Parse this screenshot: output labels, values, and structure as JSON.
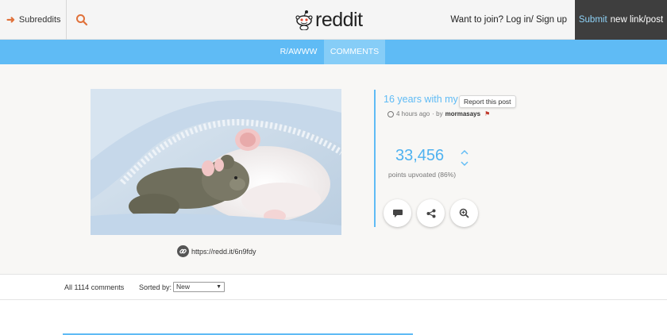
{
  "header": {
    "subreddits_label": "Subreddits",
    "logo_text": "reddit",
    "join_text": "Want to join? Log in/ Sign up",
    "submit_accent": "Submit",
    "submit_rest": "new link/post"
  },
  "nav": {
    "tabs": [
      {
        "label": "R/AWWW"
      },
      {
        "label": "COMMENTS"
      }
    ]
  },
  "post": {
    "title": "16 years with my",
    "tooltip": "Report this post",
    "time_ago": "4 hours ago",
    "by_text": "· by",
    "author": "mormasays",
    "score": "33,456",
    "score_label": "points upvoated (86%)",
    "short_link": "https://redd.it/6n9fdy"
  },
  "comments": {
    "count_label": "All 1114 comments",
    "sorted_label": "Sorted by:",
    "sort_value": "New"
  },
  "colors": {
    "accent_blue": "#5fbbf5",
    "nav_active": "#86cdf7",
    "submit_bg": "#3e3e3e",
    "arrow_orange": "#e0713a"
  }
}
